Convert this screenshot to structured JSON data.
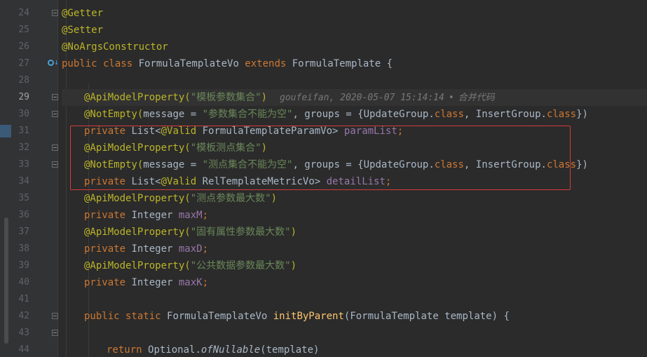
{
  "lines": [
    {
      "num": "24",
      "text": "@Getter"
    },
    {
      "num": "25",
      "text": "@Setter"
    },
    {
      "num": "26",
      "text": "@NoArgsConstructor"
    },
    {
      "num": "27",
      "t1": "public class ",
      "t2": "FormulaTemplateVo ",
      "t3": "extends ",
      "t4": "FormulaTemplate ",
      "t5": "{"
    },
    {
      "num": "28"
    },
    {
      "num": "29",
      "t1": "@ApiModelProperty(",
      "t2": "\"模板参数集合\"",
      "t3": ")"
    },
    {
      "num": "30",
      "t1": "@NotEmpty(",
      "t2": "message = ",
      "t3": "\"参数集合不能为空\"",
      "t4": ", groups = {",
      "t5": "UpdateGroup.",
      "t6": "class",
      "t7": ", InsertGroup.",
      "t8": "class",
      "t9": "})"
    },
    {
      "num": "31",
      "t1": "private ",
      "t2": "List<",
      "t3": "@Valid ",
      "t4": "FormulaTemplateParamVo> ",
      "t5": "paramList",
      "t6": ";"
    },
    {
      "num": "32",
      "t1": "@ApiModelProperty(",
      "t2": "\"模板测点集合\"",
      "t3": ")"
    },
    {
      "num": "33",
      "t1": "@NotEmpty(",
      "t2": "message = ",
      "t3": "\"测点集合不能为空\"",
      "t4": ", groups = {",
      "t5": "UpdateGroup.",
      "t6": "class",
      "t7": ", InsertGroup.",
      "t8": "class",
      "t9": "})"
    },
    {
      "num": "34",
      "t1": "private ",
      "t2": "List<",
      "t3": "@Valid ",
      "t4": "RelTemplateMetricVo> ",
      "t5": "detailList",
      "t6": ";"
    },
    {
      "num": "35",
      "t1": "@ApiModelProperty(",
      "t2": "\"测点参数最大数\"",
      "t3": ")"
    },
    {
      "num": "36",
      "t1": "private ",
      "t2": "Integer ",
      "t3": "maxM",
      "t4": ";"
    },
    {
      "num": "37",
      "t1": "@ApiModelProperty(",
      "t2": "\"固有属性参数最大数\"",
      "t3": ")"
    },
    {
      "num": "38",
      "t1": "private ",
      "t2": "Integer ",
      "t3": "maxD",
      "t4": ";"
    },
    {
      "num": "39",
      "t1": "@ApiModelProperty(",
      "t2": "\"公共数据参数最大数\"",
      "t3": ")"
    },
    {
      "num": "40",
      "t1": "private ",
      "t2": "Integer ",
      "t3": "maxK",
      "t4": ";"
    },
    {
      "num": "41"
    },
    {
      "num": "42",
      "t1": "public static ",
      "t2": "FormulaTemplateVo ",
      "t3": "initByParent",
      "t4": "(FormulaTemplate template) ",
      "t5": "{"
    },
    {
      "num": "43"
    },
    {
      "num": "44",
      "t1": "return ",
      "t2": "Optional.",
      "t3": "ofNullable",
      "t4": "(template)"
    }
  ],
  "blame": {
    "author": "goufeifan",
    "date": "2020-05-07 15:14:14",
    "separator": "•",
    "message": "合并代码"
  },
  "colors": {
    "keyword": "#cc7832",
    "annotation": "#bbb529",
    "string": "#6a8759",
    "field": "#9876aa",
    "method": "#ffc66d",
    "highlight_border": "#d63b3b"
  }
}
